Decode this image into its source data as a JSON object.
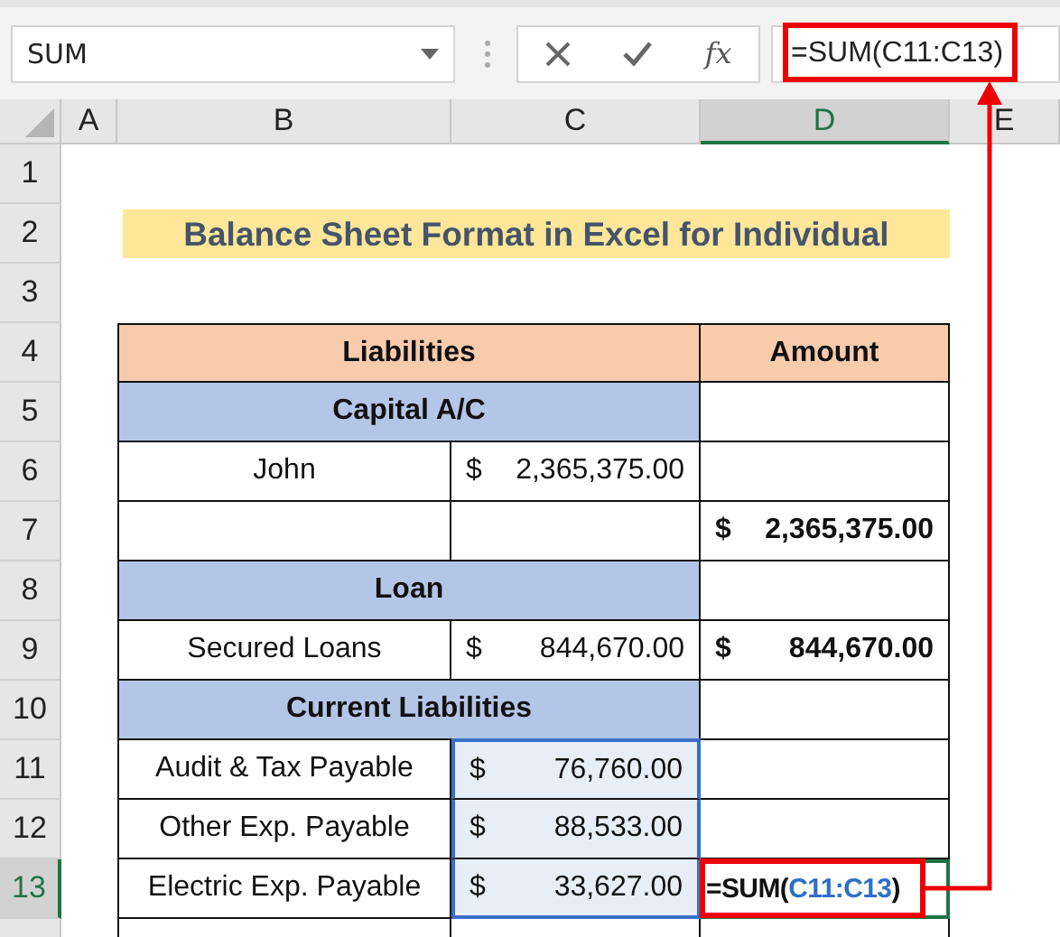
{
  "name_box": {
    "value": "SUM"
  },
  "formula_bar": {
    "function_button": "fx",
    "formula": "=SUM(C11:C13)"
  },
  "columns": [
    {
      "label": "A",
      "selected": false
    },
    {
      "label": "B",
      "selected": false
    },
    {
      "label": "C",
      "selected": false
    },
    {
      "label": "D",
      "selected": true
    },
    {
      "label": "E",
      "selected": false
    }
  ],
  "rows": [
    {
      "number": "1",
      "selected": false,
      "kind": "blank"
    },
    {
      "number": "2",
      "selected": false,
      "kind": "title",
      "label": "Balance Sheet Format in Excel for Individual"
    },
    {
      "number": "3",
      "selected": false,
      "kind": "blank"
    },
    {
      "number": "4",
      "selected": false,
      "kind": "header",
      "label": "Liabilities",
      "amount_label": "Amount"
    },
    {
      "number": "5",
      "selected": false,
      "kind": "section",
      "label": "Capital A/C"
    },
    {
      "number": "6",
      "selected": false,
      "kind": "item",
      "label": "John",
      "currency": "$",
      "amount": "2,365,375.00",
      "in_range": false
    },
    {
      "number": "7",
      "selected": false,
      "kind": "total",
      "total_currency": "$",
      "total": "2,365,375.00"
    },
    {
      "number": "8",
      "selected": false,
      "kind": "section",
      "label": "Loan"
    },
    {
      "number": "9",
      "selected": false,
      "kind": "item",
      "label": "Secured Loans",
      "currency": "$",
      "amount": "844,670.00",
      "in_range": false,
      "total_currency": "$",
      "total": "844,670.00"
    },
    {
      "number": "10",
      "selected": false,
      "kind": "section",
      "label": "Current Liabilities"
    },
    {
      "number": "11",
      "selected": false,
      "kind": "item",
      "label": "Audit & Tax Payable",
      "currency": "$",
      "amount": "76,760.00",
      "in_range": true
    },
    {
      "number": "12",
      "selected": false,
      "kind": "item",
      "label": "Other Exp. Payable",
      "currency": "$",
      "amount": "88,533.00",
      "in_range": true
    },
    {
      "number": "13",
      "selected": true,
      "kind": "item",
      "label": "Electric Exp. Payable",
      "currency": "$",
      "amount": "33,627.00",
      "in_range": true,
      "formula_prefix": "=SUM(",
      "formula_ref": "C11:C13",
      "formula_suffix": ")"
    },
    {
      "kind": "empty"
    }
  ]
}
